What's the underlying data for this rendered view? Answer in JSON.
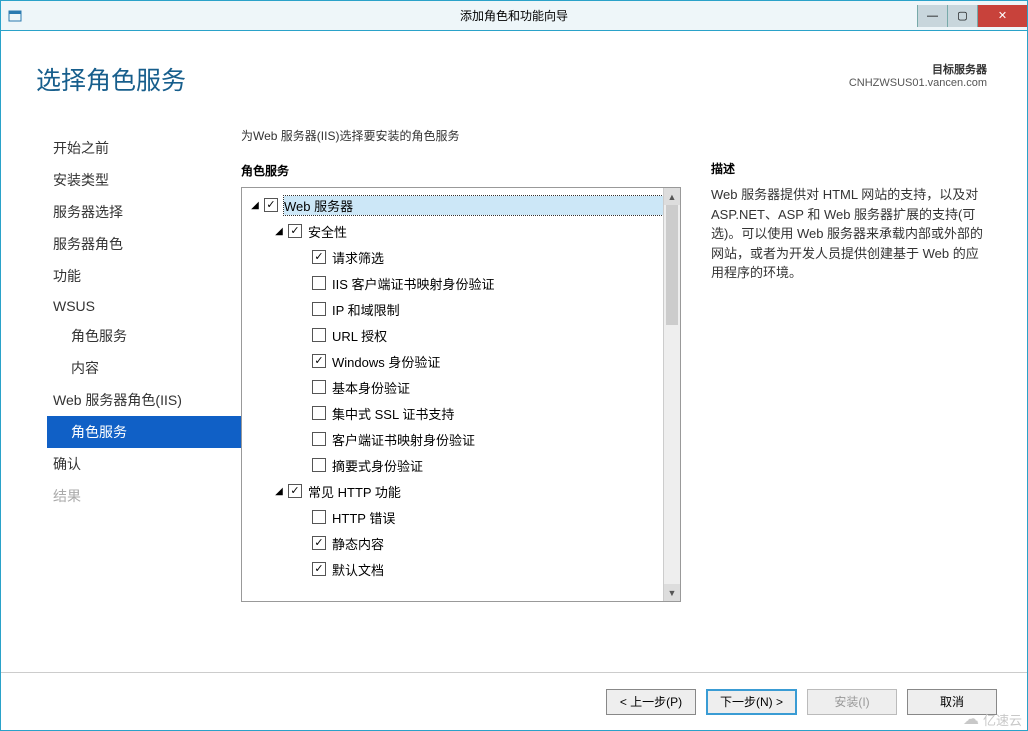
{
  "window": {
    "title": "添加角色和功能向导"
  },
  "header": {
    "page_title": "选择角色服务",
    "target_label": "目标服务器",
    "target_value": "CNHZWSUS01.vancen.com"
  },
  "sidebar": {
    "items": [
      {
        "label": "开始之前",
        "indent": 0,
        "state": "normal"
      },
      {
        "label": "安装类型",
        "indent": 0,
        "state": "normal"
      },
      {
        "label": "服务器选择",
        "indent": 0,
        "state": "normal"
      },
      {
        "label": "服务器角色",
        "indent": 0,
        "state": "normal"
      },
      {
        "label": "功能",
        "indent": 0,
        "state": "normal"
      },
      {
        "label": "WSUS",
        "indent": 0,
        "state": "normal"
      },
      {
        "label": "角色服务",
        "indent": 1,
        "state": "normal"
      },
      {
        "label": "内容",
        "indent": 1,
        "state": "normal"
      },
      {
        "label": "Web 服务器角色(IIS)",
        "indent": 0,
        "state": "normal"
      },
      {
        "label": "角色服务",
        "indent": 1,
        "state": "active"
      },
      {
        "label": "确认",
        "indent": 0,
        "state": "normal"
      },
      {
        "label": "结果",
        "indent": 0,
        "state": "disabled"
      }
    ]
  },
  "main": {
    "subtitle": "为Web 服务器(IIS)选择要安装的角色服务",
    "roles_label": "角色服务",
    "desc_label": "描述",
    "description": "Web 服务器提供对 HTML 网站的支持，以及对 ASP.NET、ASP 和 Web 服务器扩展的支持(可选)。可以使用 Web 服务器来承载内部或外部的网站，或者为开发人员提供创建基于 Web 的应用程序的环境。",
    "tree": [
      {
        "level": 0,
        "expander": "open",
        "checked": true,
        "label": "Web 服务器",
        "selected": true
      },
      {
        "level": 1,
        "expander": "open",
        "checked": true,
        "label": "安全性"
      },
      {
        "level": 2,
        "expander": "none",
        "checked": true,
        "label": "请求筛选"
      },
      {
        "level": 2,
        "expander": "none",
        "checked": false,
        "label": "IIS 客户端证书映射身份验证"
      },
      {
        "level": 2,
        "expander": "none",
        "checked": false,
        "label": "IP 和域限制"
      },
      {
        "level": 2,
        "expander": "none",
        "checked": false,
        "label": "URL 授权"
      },
      {
        "level": 2,
        "expander": "none",
        "checked": true,
        "label": "Windows 身份验证"
      },
      {
        "level": 2,
        "expander": "none",
        "checked": false,
        "label": "基本身份验证"
      },
      {
        "level": 2,
        "expander": "none",
        "checked": false,
        "label": "集中式 SSL 证书支持"
      },
      {
        "level": 2,
        "expander": "none",
        "checked": false,
        "label": "客户端证书映射身份验证"
      },
      {
        "level": 2,
        "expander": "none",
        "checked": false,
        "label": "摘要式身份验证"
      },
      {
        "level": 1,
        "expander": "open",
        "checked": true,
        "label": "常见 HTTP 功能"
      },
      {
        "level": 2,
        "expander": "none",
        "checked": false,
        "label": "HTTP 错误"
      },
      {
        "level": 2,
        "expander": "none",
        "checked": true,
        "label": "静态内容"
      },
      {
        "level": 2,
        "expander": "none",
        "checked": true,
        "label": "默认文档"
      }
    ]
  },
  "footer": {
    "prev": "< 上一步(P)",
    "next": "下一步(N) >",
    "install": "安装(I)",
    "cancel": "取消"
  },
  "watermark": "亿速云"
}
